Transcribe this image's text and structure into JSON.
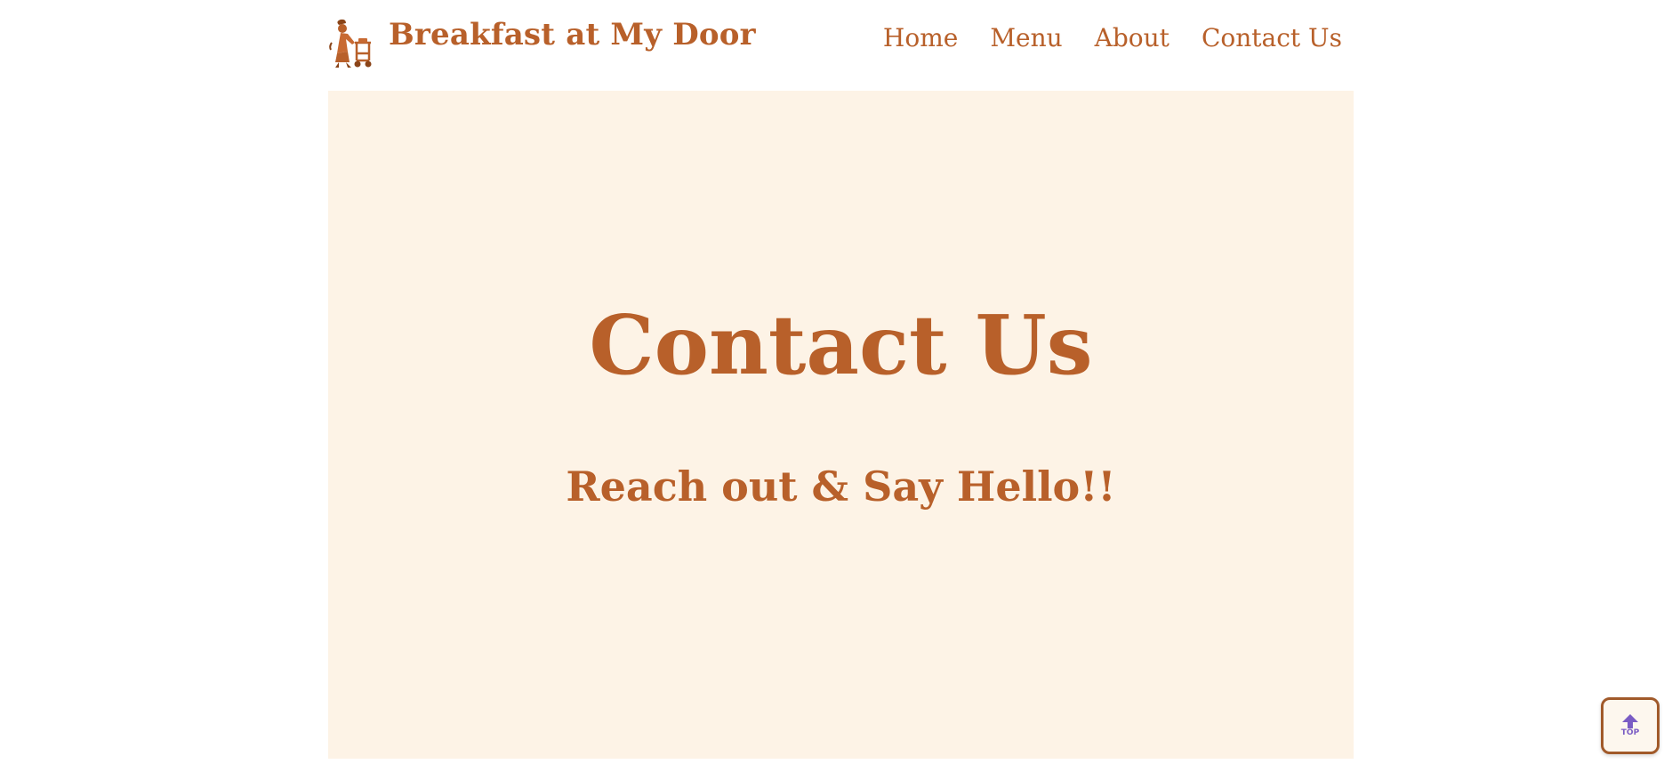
{
  "site": {
    "name": "Breakfast at My Door",
    "logo_icon": "woman-pushing-cart-icon",
    "brand_color": "#b8602a",
    "hero_background": "#fdf3e6"
  },
  "nav": {
    "items": [
      {
        "label": "Home"
      },
      {
        "label": "Menu"
      },
      {
        "label": "About"
      },
      {
        "label": "Contact Us"
      }
    ]
  },
  "hero": {
    "title": "Contact Us",
    "subtitle": "Reach out & Say Hello!!"
  },
  "back_to_top": {
    "label": "TOP",
    "icon": "arrow-up-icon",
    "icon_color": "#7a5cc4"
  }
}
